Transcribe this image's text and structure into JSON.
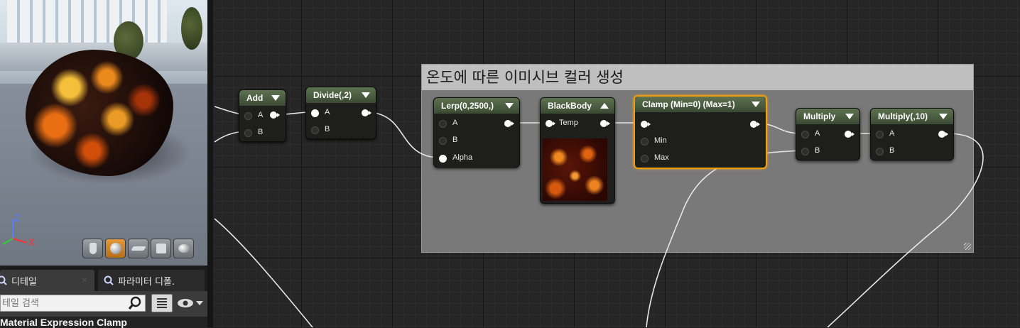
{
  "viewport": {
    "axes": {
      "x": "X",
      "z": "Z"
    },
    "toolbar": [
      {
        "icon": "cylinder-preview-icon"
      },
      {
        "icon": "sphere-preview-icon",
        "active": true
      },
      {
        "icon": "plane-preview-icon"
      },
      {
        "icon": "cube-preview-icon"
      },
      {
        "icon": "teapot-preview-icon"
      }
    ]
  },
  "tabs": {
    "details": "디테일",
    "parameters": "파라미터 디폴."
  },
  "search": {
    "placeholder": "테일 검색"
  },
  "details_title": "Material Expression Clamp",
  "comment": {
    "title": "온도에 따른 이미시브 컬러 생성"
  },
  "nodes": {
    "add": {
      "title": "Add",
      "pins": [
        "A",
        "B"
      ]
    },
    "divide": {
      "title": "Divide(,2)",
      "pins": [
        "A",
        "B"
      ]
    },
    "lerp": {
      "title": "Lerp(0,2500,)",
      "pins": [
        "A",
        "B",
        "Alpha"
      ]
    },
    "blackbody": {
      "title": "BlackBody",
      "pins": [
        "Temp"
      ]
    },
    "clamp": {
      "title": "Clamp (Min=0) (Max=1)",
      "pins": [
        "Min",
        "Max"
      ]
    },
    "multiply1": {
      "title": "Multiply",
      "pins": [
        "A",
        "B"
      ]
    },
    "multiply2": {
      "title": "Multiply(,10)",
      "pins": [
        "A",
        "B"
      ]
    }
  },
  "colors": {
    "node_header": "#4f6243",
    "selected_outline": "#f0a010",
    "comment_bg": "#797979",
    "graph_bg": "#262626"
  }
}
